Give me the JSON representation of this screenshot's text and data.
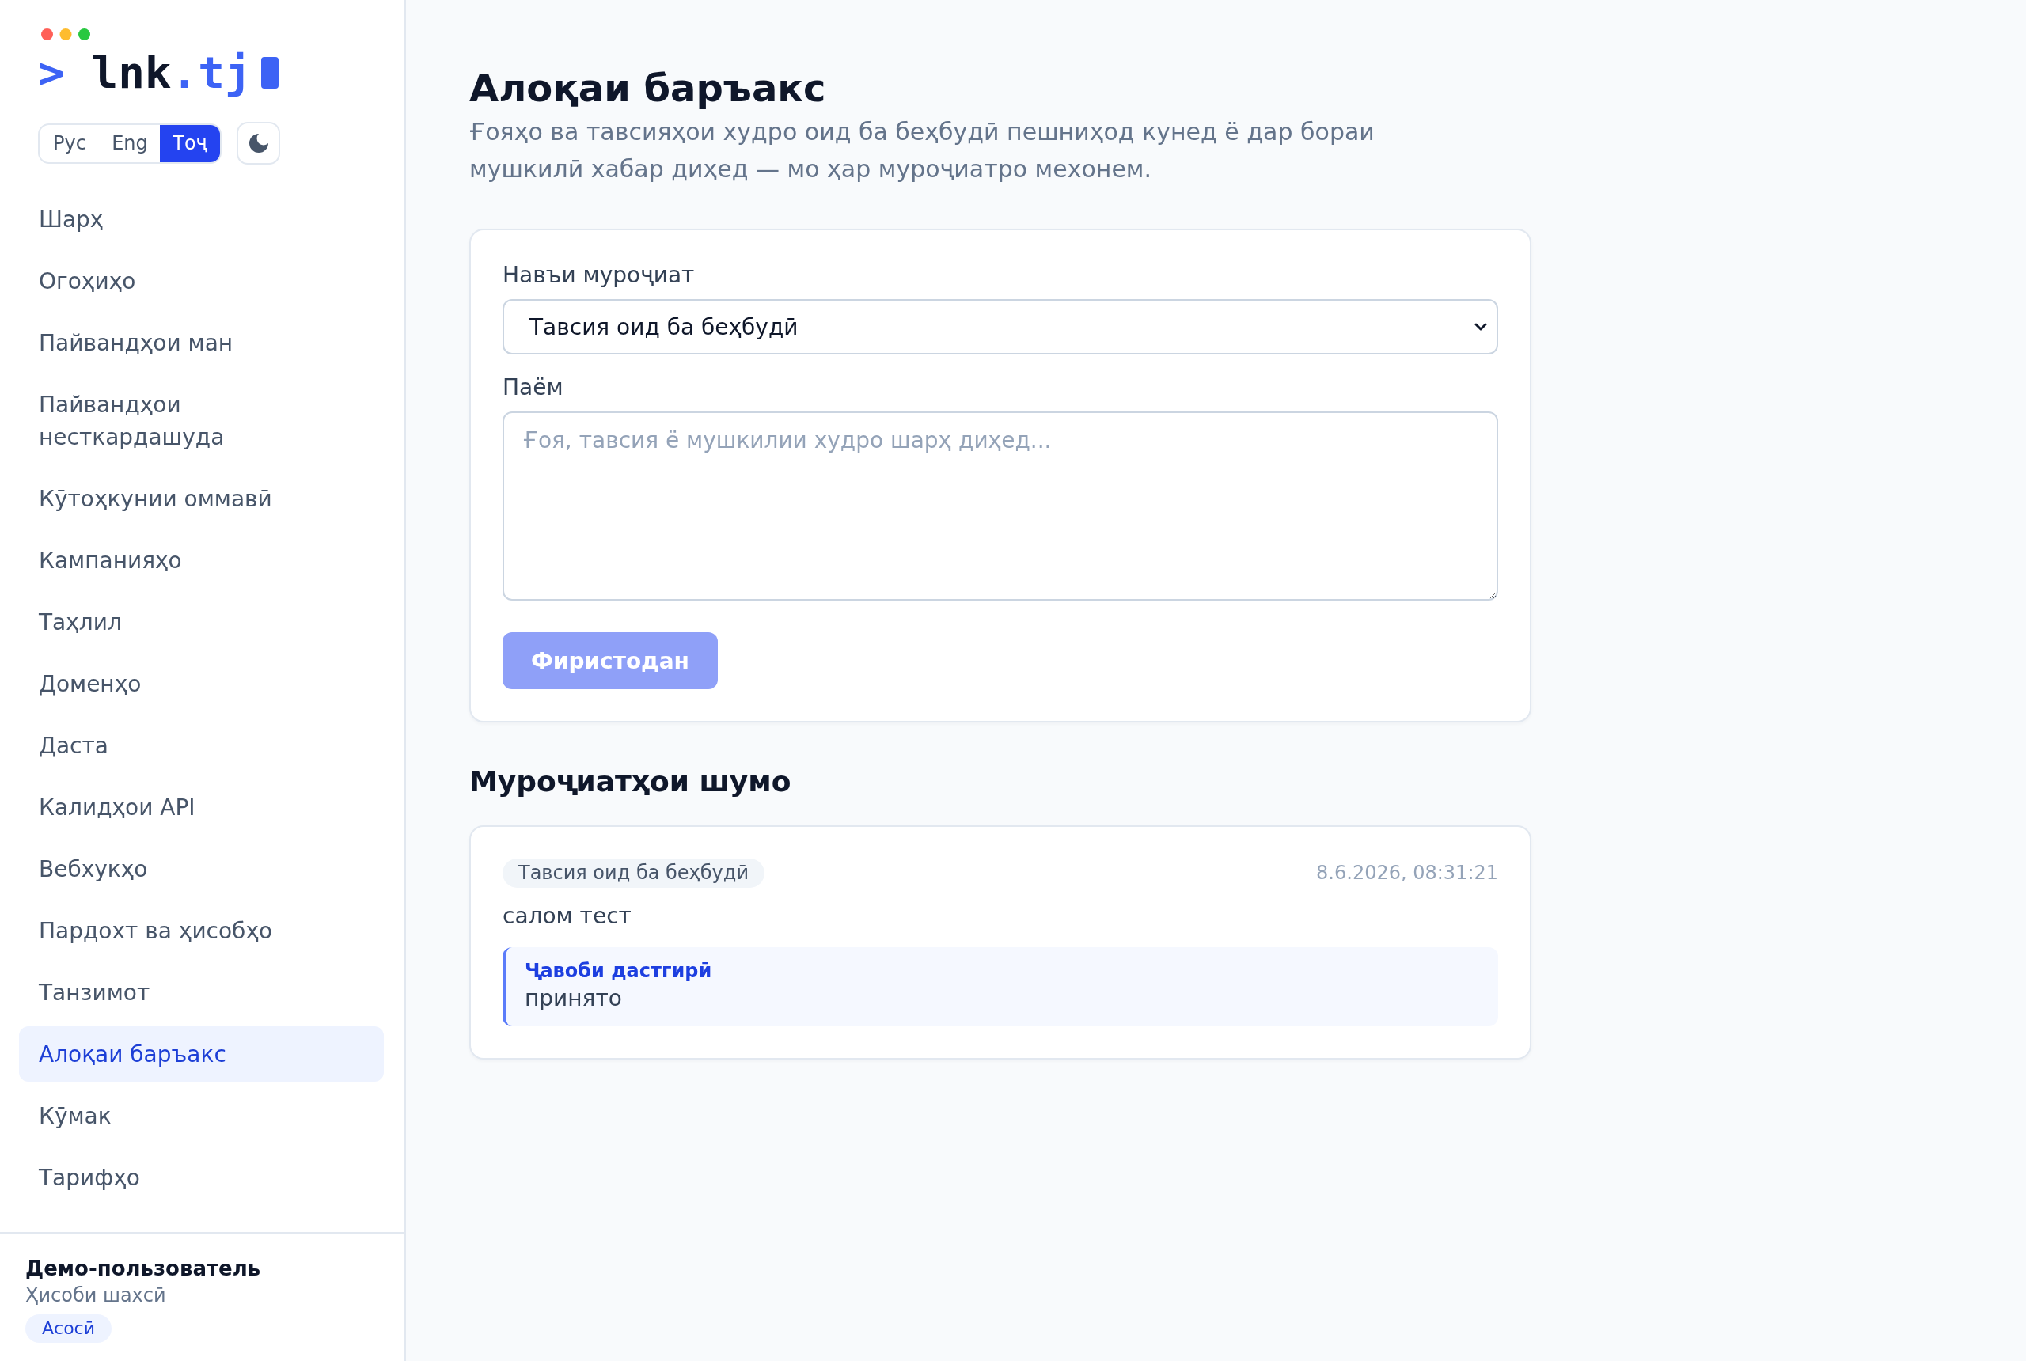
{
  "sidebar": {
    "logo": {
      "prompt": ">",
      "name": "lnk",
      "accent": ".tj"
    },
    "languages": [
      {
        "label": "Рус",
        "selected": false
      },
      {
        "label": "Eng",
        "selected": false
      },
      {
        "label": "Тоҷ",
        "selected": true
      }
    ],
    "nav_items": [
      {
        "label": "Шарҳ",
        "selected": false
      },
      {
        "label": "Огоҳиҳо",
        "selected": false
      },
      {
        "label": "Пайвандҳои ман",
        "selected": false
      },
      {
        "label": "Пайвандҳои несткардашуда",
        "selected": false
      },
      {
        "label": "Кӯтоҳкунии оммавӣ",
        "selected": false
      },
      {
        "label": "Кампанияҳо",
        "selected": false
      },
      {
        "label": "Таҳлил",
        "selected": false
      },
      {
        "label": "Доменҳо",
        "selected": false
      },
      {
        "label": "Даста",
        "selected": false
      },
      {
        "label": "Калидҳои API",
        "selected": false
      },
      {
        "label": "Вебхукҳо",
        "selected": false
      },
      {
        "label": "Пардохт ва ҳисобҳо",
        "selected": false
      },
      {
        "label": "Танзимот",
        "selected": false
      },
      {
        "label": "Алоқаи баръакс",
        "selected": true
      },
      {
        "label": "Кӯмак",
        "selected": false
      },
      {
        "label": "Тарифҳо",
        "selected": false
      }
    ],
    "user": {
      "name": "Демо-пользователь",
      "account": "Ҳисоби шахсӣ",
      "plan": "Асосӣ"
    }
  },
  "main": {
    "title": "Алоқаи баръакс",
    "subtitle": "Ғояҳо ва тавсияҳои худро оид ба беҳбудӣ пешниҳод кунед ё дар бораи мушкилӣ хабар диҳед — мо ҳар муроҷиатро мехонем.",
    "form": {
      "type": {
        "label": "Навъи муроҷиат",
        "value": "Тавсия оид ба беҳбудӣ"
      },
      "message": {
        "label": "Паём",
        "placeholder": "Ғоя, тавсия ё мушкилии худро шарҳ диҳед..."
      },
      "submit": {
        "label": "Фиристодан",
        "disabled": true
      }
    },
    "requests_title": "Муроҷиатҳои шумо",
    "requests": [
      {
        "type": "Тавсия оид ба беҳбудӣ",
        "date": "8.6.2026, 08:31:21",
        "message": "салом тест",
        "reply": {
          "label": "Ҷавоби дастгирӣ",
          "text": "принято"
        }
      }
    ]
  }
}
